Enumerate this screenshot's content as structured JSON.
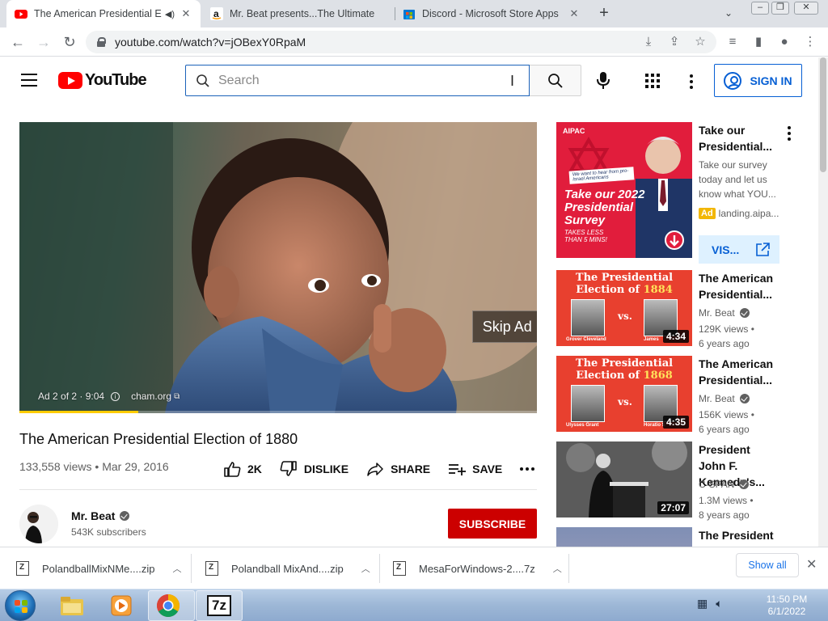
{
  "browser": {
    "tabs": [
      {
        "title": "The American Presidential El",
        "active": true,
        "favicon": "youtube-icon"
      },
      {
        "title": "Mr. Beat presents...The Ultimate",
        "active": false,
        "favicon": "amazon-icon"
      },
      {
        "title": "Discord - Microsoft Store Apps",
        "active": false,
        "favicon": "microsoft-store-icon"
      }
    ],
    "url": "youtube.com/watch?v=jOBexY0RpaM"
  },
  "header": {
    "logo_text": "YouTube",
    "search_placeholder": "Search",
    "signin_label": "SIGN IN"
  },
  "player": {
    "skip_label": "Skip Ad",
    "ad_counter": "Ad 2 of 2 · 9:04",
    "ad_domain": "cham.org",
    "progress_fraction": 0.23
  },
  "video": {
    "title": "The American Presidential Election of 1880",
    "views": "133,558 views",
    "date": "Mar 29, 2016",
    "like_count": "2K",
    "dislike_label": "DISLIKE",
    "share_label": "SHARE",
    "save_label": "SAVE"
  },
  "channel": {
    "name": "Mr. Beat",
    "subscribers": "543K subscribers",
    "subscribe_label": "SUBSCRIBE"
  },
  "sidebar": {
    "ad": {
      "title": "Take our Presidential...",
      "description": "Take our survey today and let us know what YOU...",
      "badge": "Ad",
      "domain": "landing.aipa...",
      "visit_label": "VIS...",
      "thumb_brand": "AIPAC",
      "thumb_small": "We want to hear from pro-Israel Americans",
      "thumb_title": "Take our 2022 Presidential Survey",
      "thumb_sub": "TAKES LESS THAN 5 MINS!"
    },
    "videos": [
      {
        "title": "The American Presidential...",
        "channel": "Mr. Beat",
        "views": "129K views •",
        "age": "6 years ago",
        "duration": "4:34",
        "thumb_line1": "The Presidential",
        "thumb_line2a": "Election of ",
        "thumb_year": "1884",
        "thumb_vs": "vs.",
        "left_name": "Grover Cleveland",
        "right_name": "James"
      },
      {
        "title": "The American Presidential...",
        "channel": "Mr. Beat",
        "views": "156K views •",
        "age": "6 years ago",
        "duration": "4:35",
        "thumb_line1": "The Presidential",
        "thumb_line2a": "Election of ",
        "thumb_year": "1868",
        "thumb_vs": "vs.",
        "left_name": "Ulysses Grant",
        "right_name": "Horatio S"
      },
      {
        "title": "President John F. Kennedy's...",
        "channel": "C-SPAN",
        "views": "1.3M views •",
        "age": "8 years ago",
        "duration": "27:07"
      },
      {
        "title": "The President"
      }
    ]
  },
  "downloads": {
    "items": [
      {
        "name": "PolandballMixNMe....zip"
      },
      {
        "name": "Polandball MixAnd....zip"
      },
      {
        "name": "MesaForWindows-2....7z"
      }
    ],
    "show_all_label": "Show all"
  },
  "taskbar": {
    "time": "11:50 PM",
    "date": "6/1/2022",
    "apps": [
      "explorer-icon",
      "media-player-icon",
      "chrome-icon",
      "7zip-icon"
    ],
    "seven_zip_label": "7z"
  }
}
